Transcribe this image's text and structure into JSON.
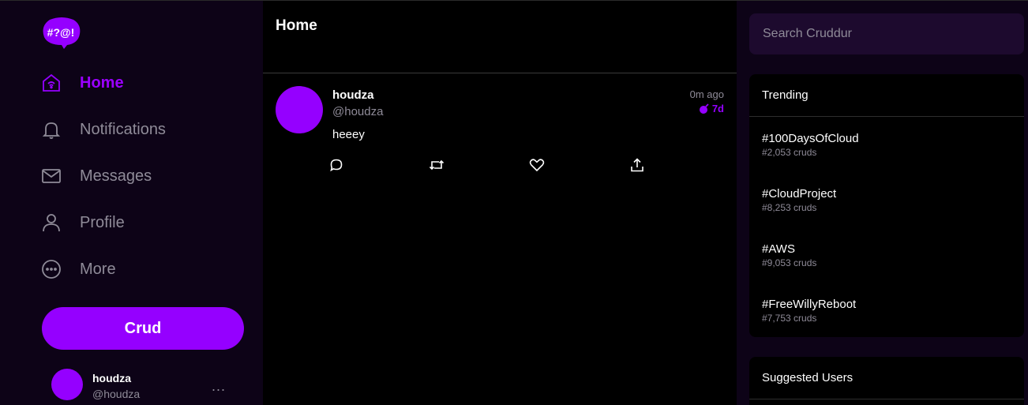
{
  "app": {
    "logo_text": "#?@!",
    "accent": "#9500ff"
  },
  "sidebar": {
    "items": [
      {
        "label": "Home",
        "icon": "home-icon",
        "active": true
      },
      {
        "label": "Notifications",
        "icon": "bell-icon"
      },
      {
        "label": "Messages",
        "icon": "envelope-icon"
      },
      {
        "label": "Profile",
        "icon": "user-icon"
      },
      {
        "label": "More",
        "icon": "more-circle-icon"
      }
    ],
    "crud_button": "Crud",
    "user": {
      "name": "houdza",
      "handle": "@houdza",
      "more": "..."
    }
  },
  "main": {
    "title": "Home",
    "activities": [
      {
        "name": "houdza",
        "handle": "@houdza",
        "time": "0m ago",
        "expires": "7d",
        "message": "heeey"
      }
    ]
  },
  "right": {
    "search_placeholder": "Search Cruddur",
    "trending": {
      "title": "Trending",
      "items": [
        {
          "name": "#100DaysOfCloud",
          "count": "#2,053 cruds"
        },
        {
          "name": "#CloudProject",
          "count": "#8,253 cruds"
        },
        {
          "name": "#AWS",
          "count": "#9,053 cruds"
        },
        {
          "name": "#FreeWillyReboot",
          "count": "#7,753 cruds"
        }
      ]
    },
    "suggested": {
      "title": "Suggested Users"
    }
  }
}
